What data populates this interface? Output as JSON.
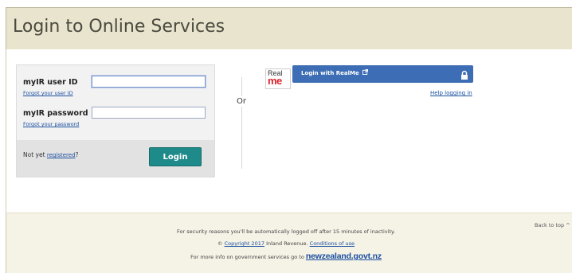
{
  "header": {
    "title": "Login to Online Services"
  },
  "login": {
    "user_id_label": "myIR user ID",
    "user_id_value": "",
    "forgot_user_id": "Forgot your user ID",
    "password_label": "myIR password",
    "password_value": "",
    "forgot_password": "Forgot your password",
    "not_yet_prefix": "Not yet ",
    "registered_link": "registered",
    "not_yet_suffix": "?",
    "login_button": "Login"
  },
  "separator": {
    "or": "Or"
  },
  "realme": {
    "logo_top": "Real",
    "logo_bottom": "me",
    "button_label": "Login with RealMe",
    "external_icon": "external-link-icon",
    "lock_icon": "lock-icon",
    "help_link": "Help logging in",
    "button_color": "#3d6db4",
    "logo_red": "#d8232a"
  },
  "footer": {
    "back_to_top": "Back to top ^",
    "security_notice": "For security reasons you'll be automatically logged off after 15 minutes of inactivity.",
    "copyright_symbol": "©",
    "copyright_link": "Copyright 2017",
    "org": "Inland Revenue.",
    "conditions_link": "Conditions of use",
    "govt_prefix": "For more info on government services go to",
    "govt_link": "newzealand.govt.nz"
  },
  "colors": {
    "header_bg": "#e9e4ce",
    "login_button": "#1f8a8a",
    "link": "#1a4fa0"
  }
}
